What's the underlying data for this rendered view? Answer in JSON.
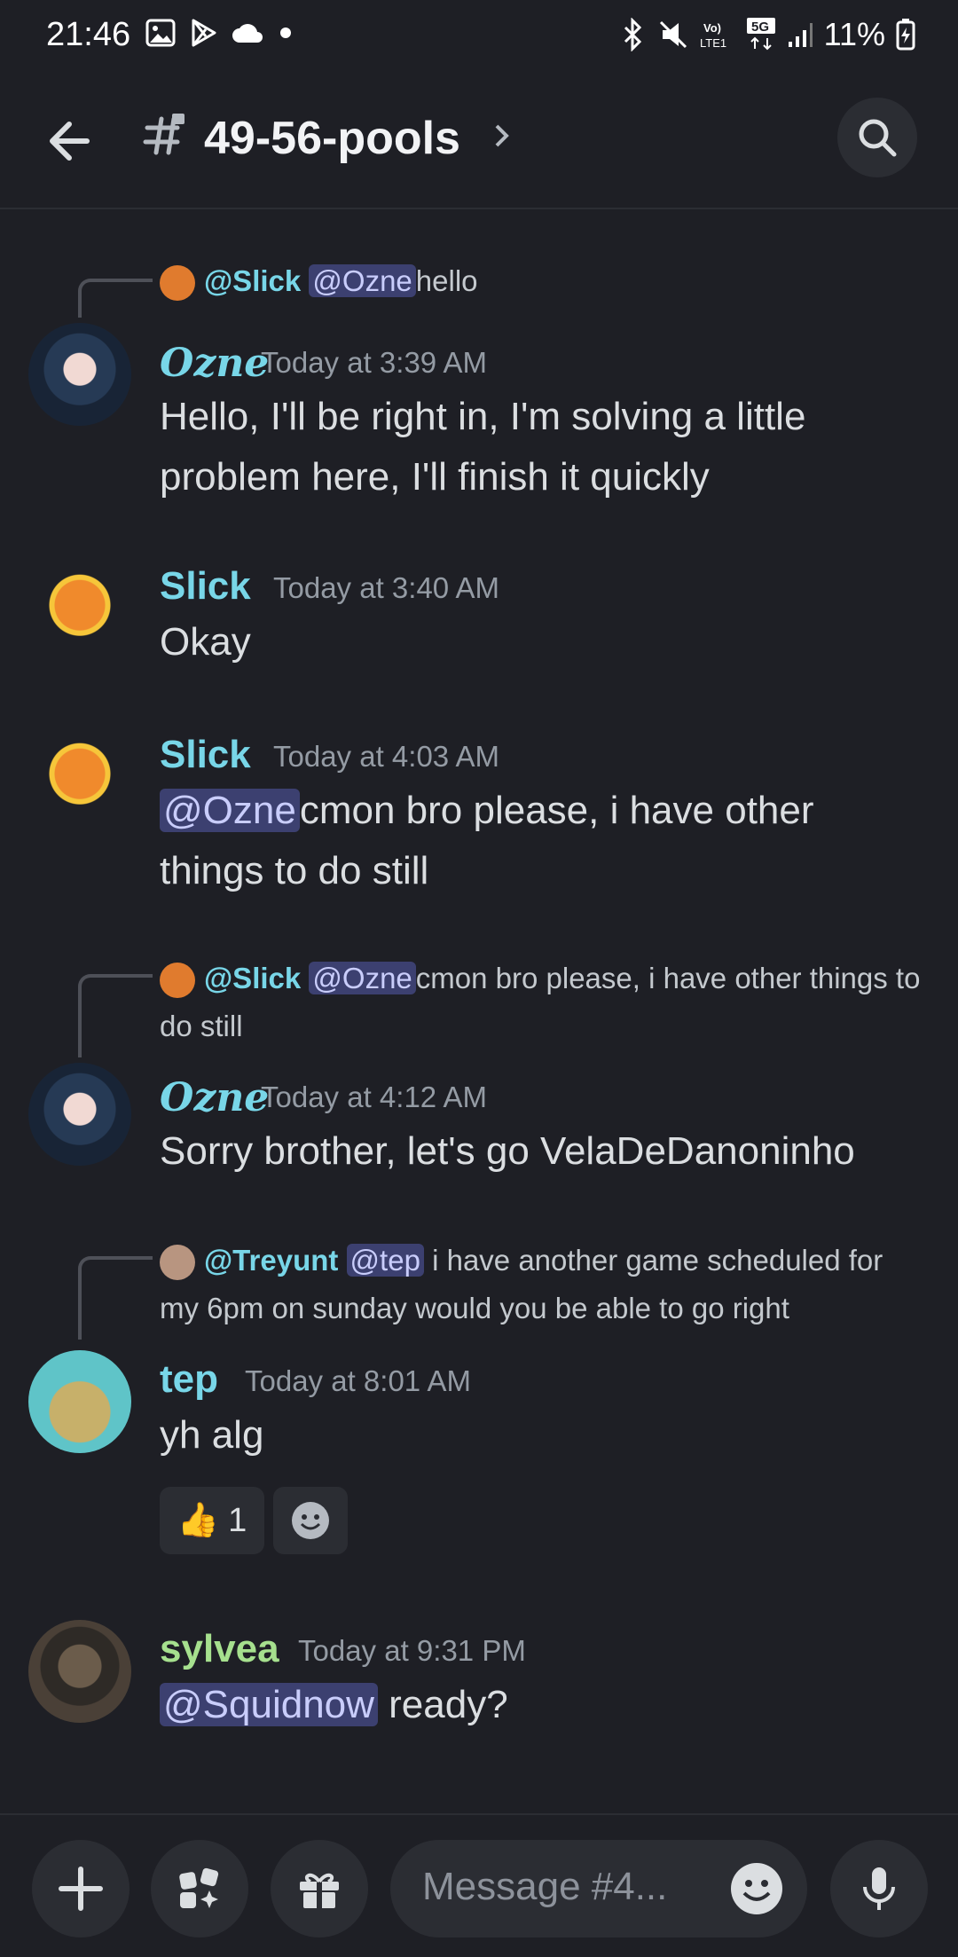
{
  "status_bar": {
    "time": "21:46",
    "battery": "11%"
  },
  "header": {
    "channel": "49-56-pools"
  },
  "messages": [
    {
      "reply": {
        "user": "@Slick",
        "mention": "@Ozne",
        "text": "hello"
      },
      "user": "Ozne",
      "time": "Today at 3:39 AM",
      "text": "Hello, I'll be right in, I'm solving a little problem here, I'll finish it quickly"
    },
    {
      "user": "Slick",
      "time": "Today at 3:40 AM",
      "text": "Okay"
    },
    {
      "user": "Slick",
      "time": "Today at 4:03 AM",
      "mention": "@Ozne",
      "text": "cmon bro please, i have other things to do still"
    },
    {
      "reply": {
        "user": "@Slick",
        "mention": "@Ozne",
        "text": "cmon bro please, i have other things to do still"
      },
      "user": "Ozne",
      "time": "Today at 4:12 AM",
      "text": "Sorry brother, let's go VelaDeDanoninho"
    },
    {
      "reply": {
        "user": "@Treyunt",
        "mention": "@tep",
        "text": "i have another game scheduled for my 6pm on sunday would you be able to go right"
      },
      "user": "tep",
      "time": "Today at 8:01 AM",
      "text": "yh alg",
      "reaction": {
        "emoji": "👍",
        "count": "1"
      }
    },
    {
      "user": "sylvea",
      "time": "Today at 9:31 PM",
      "mention": "@Squidnow",
      "text": "ready?"
    }
  ],
  "composer": {
    "placeholder": "Message #4..."
  },
  "colors": {
    "background": "#1e1f25",
    "username_cyan": "#78d6e8",
    "username_green": "#a6e08e",
    "mention_bg": "#3c4070"
  }
}
